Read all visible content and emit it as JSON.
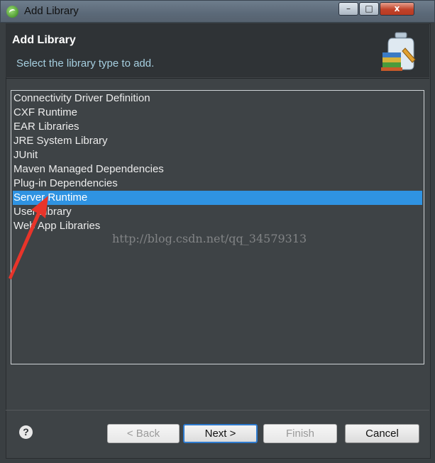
{
  "window": {
    "title": "Add Library",
    "minimize": "–",
    "maximize": "□",
    "close": "x"
  },
  "header": {
    "title": "Add Library",
    "description": "Select the library type to add."
  },
  "library_types": [
    {
      "label": "Connectivity Driver Definition",
      "selected": false
    },
    {
      "label": "CXF Runtime",
      "selected": false
    },
    {
      "label": "EAR Libraries",
      "selected": false
    },
    {
      "label": "JRE System Library",
      "selected": false
    },
    {
      "label": "JUnit",
      "selected": false
    },
    {
      "label": "Maven Managed Dependencies",
      "selected": false
    },
    {
      "label": "Plug-in Dependencies",
      "selected": false
    },
    {
      "label": "Server Runtime",
      "selected": true
    },
    {
      "label": "User Library",
      "selected": false
    },
    {
      "label": "Web App Libraries",
      "selected": false
    }
  ],
  "watermark": "http://blog.csdn.net/qq_34579313",
  "buttons": {
    "back": "< Back",
    "next": "Next >",
    "finish": "Finish",
    "cancel": "Cancel"
  },
  "help": "?",
  "colors": {
    "selection": "#2f93e2",
    "annotation_arrow": "#e8342a"
  }
}
